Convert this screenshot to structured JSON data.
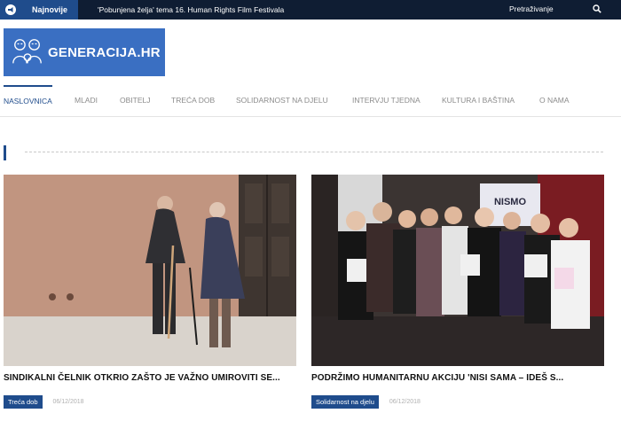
{
  "topbar": {
    "latest_label": "Najnovije",
    "ticker": "'Pobunjena želja' tema 16. Human Rights Film Festivala",
    "search_placeholder": "Pretraživanje"
  },
  "logo": {
    "text": "GENERACIJA.HR"
  },
  "nav": [
    {
      "label": "NASLOVNICA",
      "active": true
    },
    {
      "label": "MLADI"
    },
    {
      "label": "OBITELJ"
    },
    {
      "label": "TREĆA DOB"
    },
    {
      "label": "SOLIDARNOST NA DJELU"
    },
    {
      "label": "INTERVJU TJEDNA"
    },
    {
      "label": "KULTURA I BAŠTINA"
    },
    {
      "label": "O NAMA"
    }
  ],
  "articles": [
    {
      "title": "SINDIKALNI ČELNIK OTKRIO ZAŠTO JE VAŽNO UMIROVITI SE...",
      "category": "Treća dob",
      "date": "06/12/2018"
    },
    {
      "title": "PODRŽIMO HUMANITARNU AKCIJU 'NISI SAMA – IDEŠ S...",
      "category": "Solidarnost na djelu",
      "date": "06/12/2018",
      "banner_text": "NISMO"
    }
  ],
  "colors": {
    "accent": "#1f4c8c",
    "topbar": "#0f1d33",
    "logo_bg": "#3a6fc2"
  }
}
